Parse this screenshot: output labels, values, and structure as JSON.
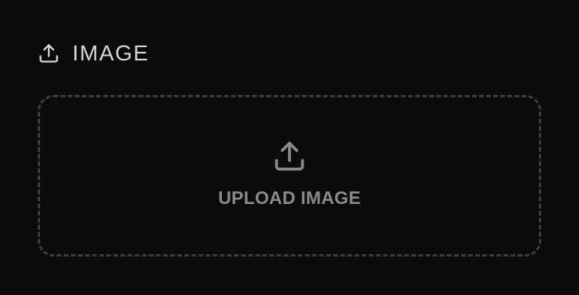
{
  "section": {
    "title": "IMAGE",
    "icon": "upload-icon"
  },
  "dropzone": {
    "label": "UPLOAD IMAGE",
    "icon": "upload-icon"
  },
  "colors": {
    "background": "#0b0b0c",
    "title_text": "#d6d6d8",
    "dropzone_border": "#3c3c3f",
    "dropzone_text": "#8a8a8d",
    "dropzone_icon": "#8a8a8d"
  }
}
